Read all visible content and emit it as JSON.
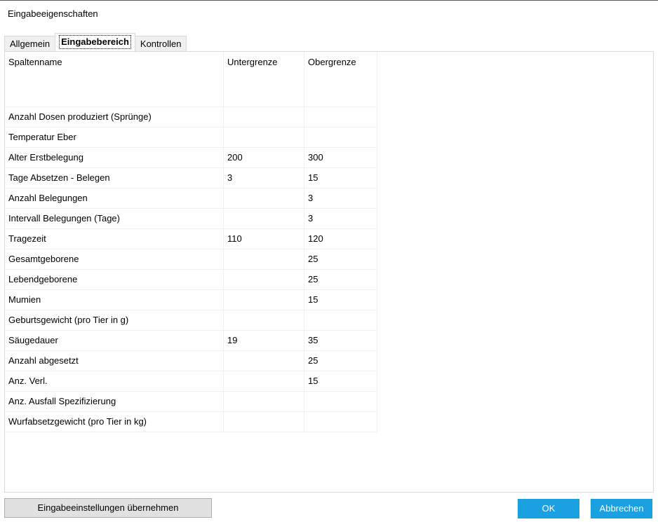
{
  "window": {
    "title": "Eingabeeigenschaften"
  },
  "tabs": [
    {
      "label": "Allgemein",
      "active": false
    },
    {
      "label": "Eingabebereich",
      "active": true
    },
    {
      "label": "Kontrollen",
      "active": false
    }
  ],
  "table": {
    "columns": [
      "Spaltenname",
      "Untergrenze",
      "Obergrenze"
    ],
    "rows": [
      {
        "name": "Anzahl Dosen produziert (Sprünge)",
        "lower": "",
        "upper": ""
      },
      {
        "name": "Temperatur Eber",
        "lower": "",
        "upper": ""
      },
      {
        "name": "Alter Erstbelegung",
        "lower": "200",
        "upper": "300"
      },
      {
        "name": "Tage Absetzen - Belegen",
        "lower": "3",
        "upper": "15"
      },
      {
        "name": "Anzahl Belegungen",
        "lower": "",
        "upper": "3"
      },
      {
        "name": "Intervall Belegungen (Tage)",
        "lower": "",
        "upper": "3"
      },
      {
        "name": "Tragezeit",
        "lower": "110",
        "upper": "120"
      },
      {
        "name": "Gesamtgeborene",
        "lower": "",
        "upper": "25"
      },
      {
        "name": "Lebendgeborene",
        "lower": "",
        "upper": "25"
      },
      {
        "name": "Mumien",
        "lower": "",
        "upper": "15"
      },
      {
        "name": "Geburtsgewicht (pro Tier in g)",
        "lower": "",
        "upper": ""
      },
      {
        "name": "Säugedauer",
        "lower": "19",
        "upper": "35"
      },
      {
        "name": "Anzahl abgesetzt",
        "lower": "",
        "upper": "25"
      },
      {
        "name": "Anz. Verl.",
        "lower": "",
        "upper": "15"
      },
      {
        "name": "Anz. Ausfall Spezifizierung",
        "lower": "",
        "upper": ""
      },
      {
        "name": "Wurfabsetzgewicht (pro Tier in kg)",
        "lower": "",
        "upper": ""
      }
    ]
  },
  "footer": {
    "apply_label": "Eingabeeinstellungen übernehmen",
    "ok_label": "OK",
    "cancel_label": "Abbrechen"
  },
  "colors": {
    "accent": "#1ba1e2",
    "grid_line": "#f0f0f0"
  }
}
